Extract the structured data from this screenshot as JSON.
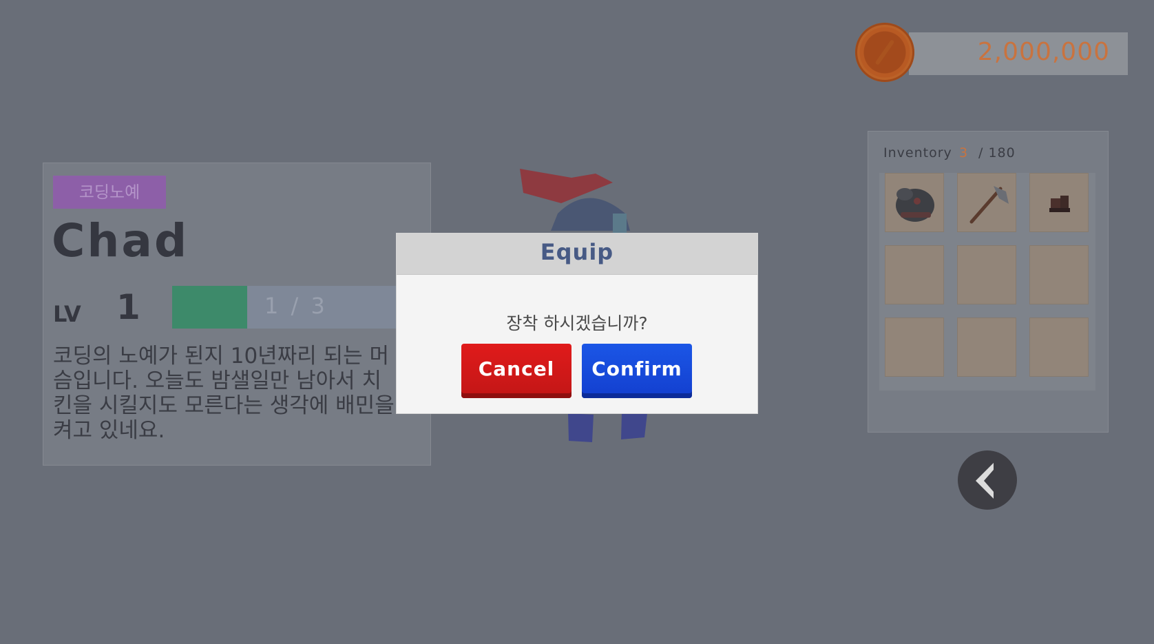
{
  "coins": {
    "amount": "2,000,000"
  },
  "character": {
    "badge": "코딩노예",
    "name": "Chad",
    "level_label": "LV",
    "level": "1",
    "xp_text": "1 / 3",
    "xp_progress": 0.33,
    "description": "코딩의 노예가 된지 10년짜리 되는 머슴입니다. 오늘도 밤샐일만 남아서 치킨을 시킬지도 모른다는 생각에 배민을 켜고 있네요."
  },
  "inventory": {
    "title": "Inventory",
    "count": "3",
    "max": "/ 180",
    "slots": [
      {
        "item": "armor-icon"
      },
      {
        "item": "axe-icon"
      },
      {
        "item": "boots-icon"
      },
      {
        "item": ""
      },
      {
        "item": ""
      },
      {
        "item": ""
      },
      {
        "item": ""
      },
      {
        "item": ""
      },
      {
        "item": ""
      }
    ]
  },
  "modal": {
    "title": "Equip",
    "message": "장착 하시겠습니까?",
    "cancel_label": "Cancel",
    "confirm_label": "Confirm"
  },
  "colors": {
    "background": "#696e78",
    "accent_orange": "#c9733f",
    "cancel": "#d61919",
    "confirm": "#1748da",
    "title": "#475a85"
  }
}
